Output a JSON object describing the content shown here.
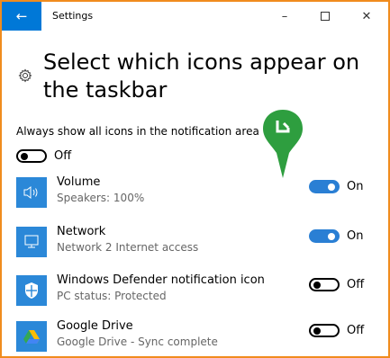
{
  "window": {
    "title": "Settings",
    "back_icon": "arrow-left-icon",
    "minimize_glyph": "–",
    "maximize_glyph": "☐",
    "close_glyph": "✕"
  },
  "page": {
    "heading": "Select which icons appear on the taskbar",
    "heading_icon": "gear-icon"
  },
  "master": {
    "label": "Always show all icons in the notification area",
    "state": "Off"
  },
  "items": [
    {
      "name": "Volume",
      "status": "Speakers: 100%",
      "state": "On",
      "icon": "speaker-icon"
    },
    {
      "name": "Network",
      "status": "Network  2 Internet access",
      "state": "On",
      "icon": "monitor-icon"
    },
    {
      "name": "Windows Defender notification icon",
      "status": "PC status: Protected",
      "state": "Off",
      "icon": "shield-icon"
    },
    {
      "name": "Google Drive",
      "status": "Google Drive - Sync complete",
      "state": "Off",
      "icon": "google-drive-icon"
    }
  ],
  "colors": {
    "accent": "#2a7fd4",
    "titlebar_back": "#0078d7",
    "app_icon_bg": "#2b88d8",
    "frame_border": "#f08c1e",
    "badge_green": "#2e9e3f"
  }
}
